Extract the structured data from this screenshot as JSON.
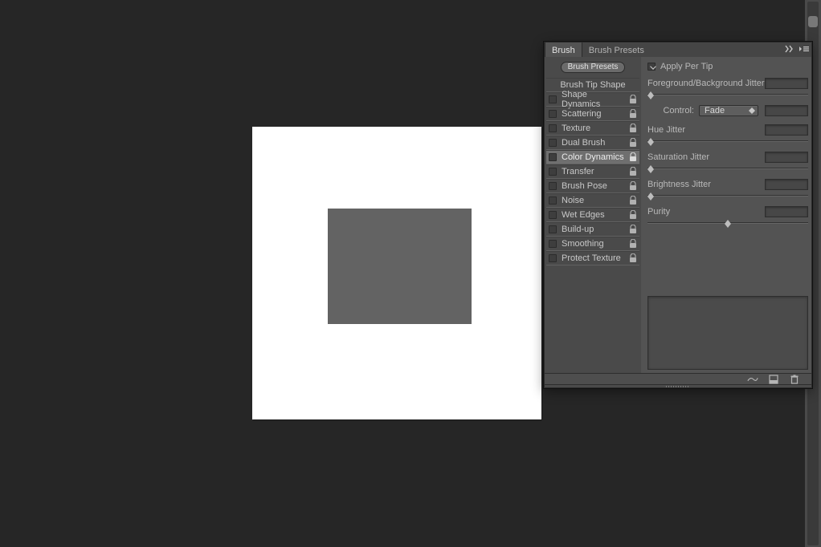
{
  "panel": {
    "tabs": {
      "brush": "Brush",
      "presets": "Brush Presets"
    },
    "presets_button": "Brush Presets",
    "options": {
      "tip_shape": "Brush Tip Shape",
      "items": [
        {
          "label": "Shape Dynamics",
          "lock": true
        },
        {
          "label": "Scattering",
          "lock": true
        },
        {
          "label": "Texture",
          "lock": true
        },
        {
          "label": "Dual Brush",
          "lock": true
        },
        {
          "label": "Color Dynamics",
          "lock": true,
          "selected": true
        },
        {
          "label": "Transfer",
          "lock": true
        },
        {
          "label": "Brush Pose",
          "lock": true
        },
        {
          "label": "Noise",
          "lock": true
        },
        {
          "label": "Wet Edges",
          "lock": true
        },
        {
          "label": "Build-up",
          "lock": true
        },
        {
          "label": "Smoothing",
          "lock": true
        },
        {
          "label": "Protect Texture",
          "lock": true
        }
      ]
    },
    "right": {
      "apply_per_tip": "Apply Per Tip",
      "fg_bg_jitter": "Foreground/Background Jitter",
      "control_label": "Control:",
      "control_value": "Fade",
      "hue_jitter": "Hue Jitter",
      "saturation_jitter": "Saturation Jitter",
      "brightness_jitter": "Brightness Jitter",
      "purity": "Purity"
    }
  }
}
